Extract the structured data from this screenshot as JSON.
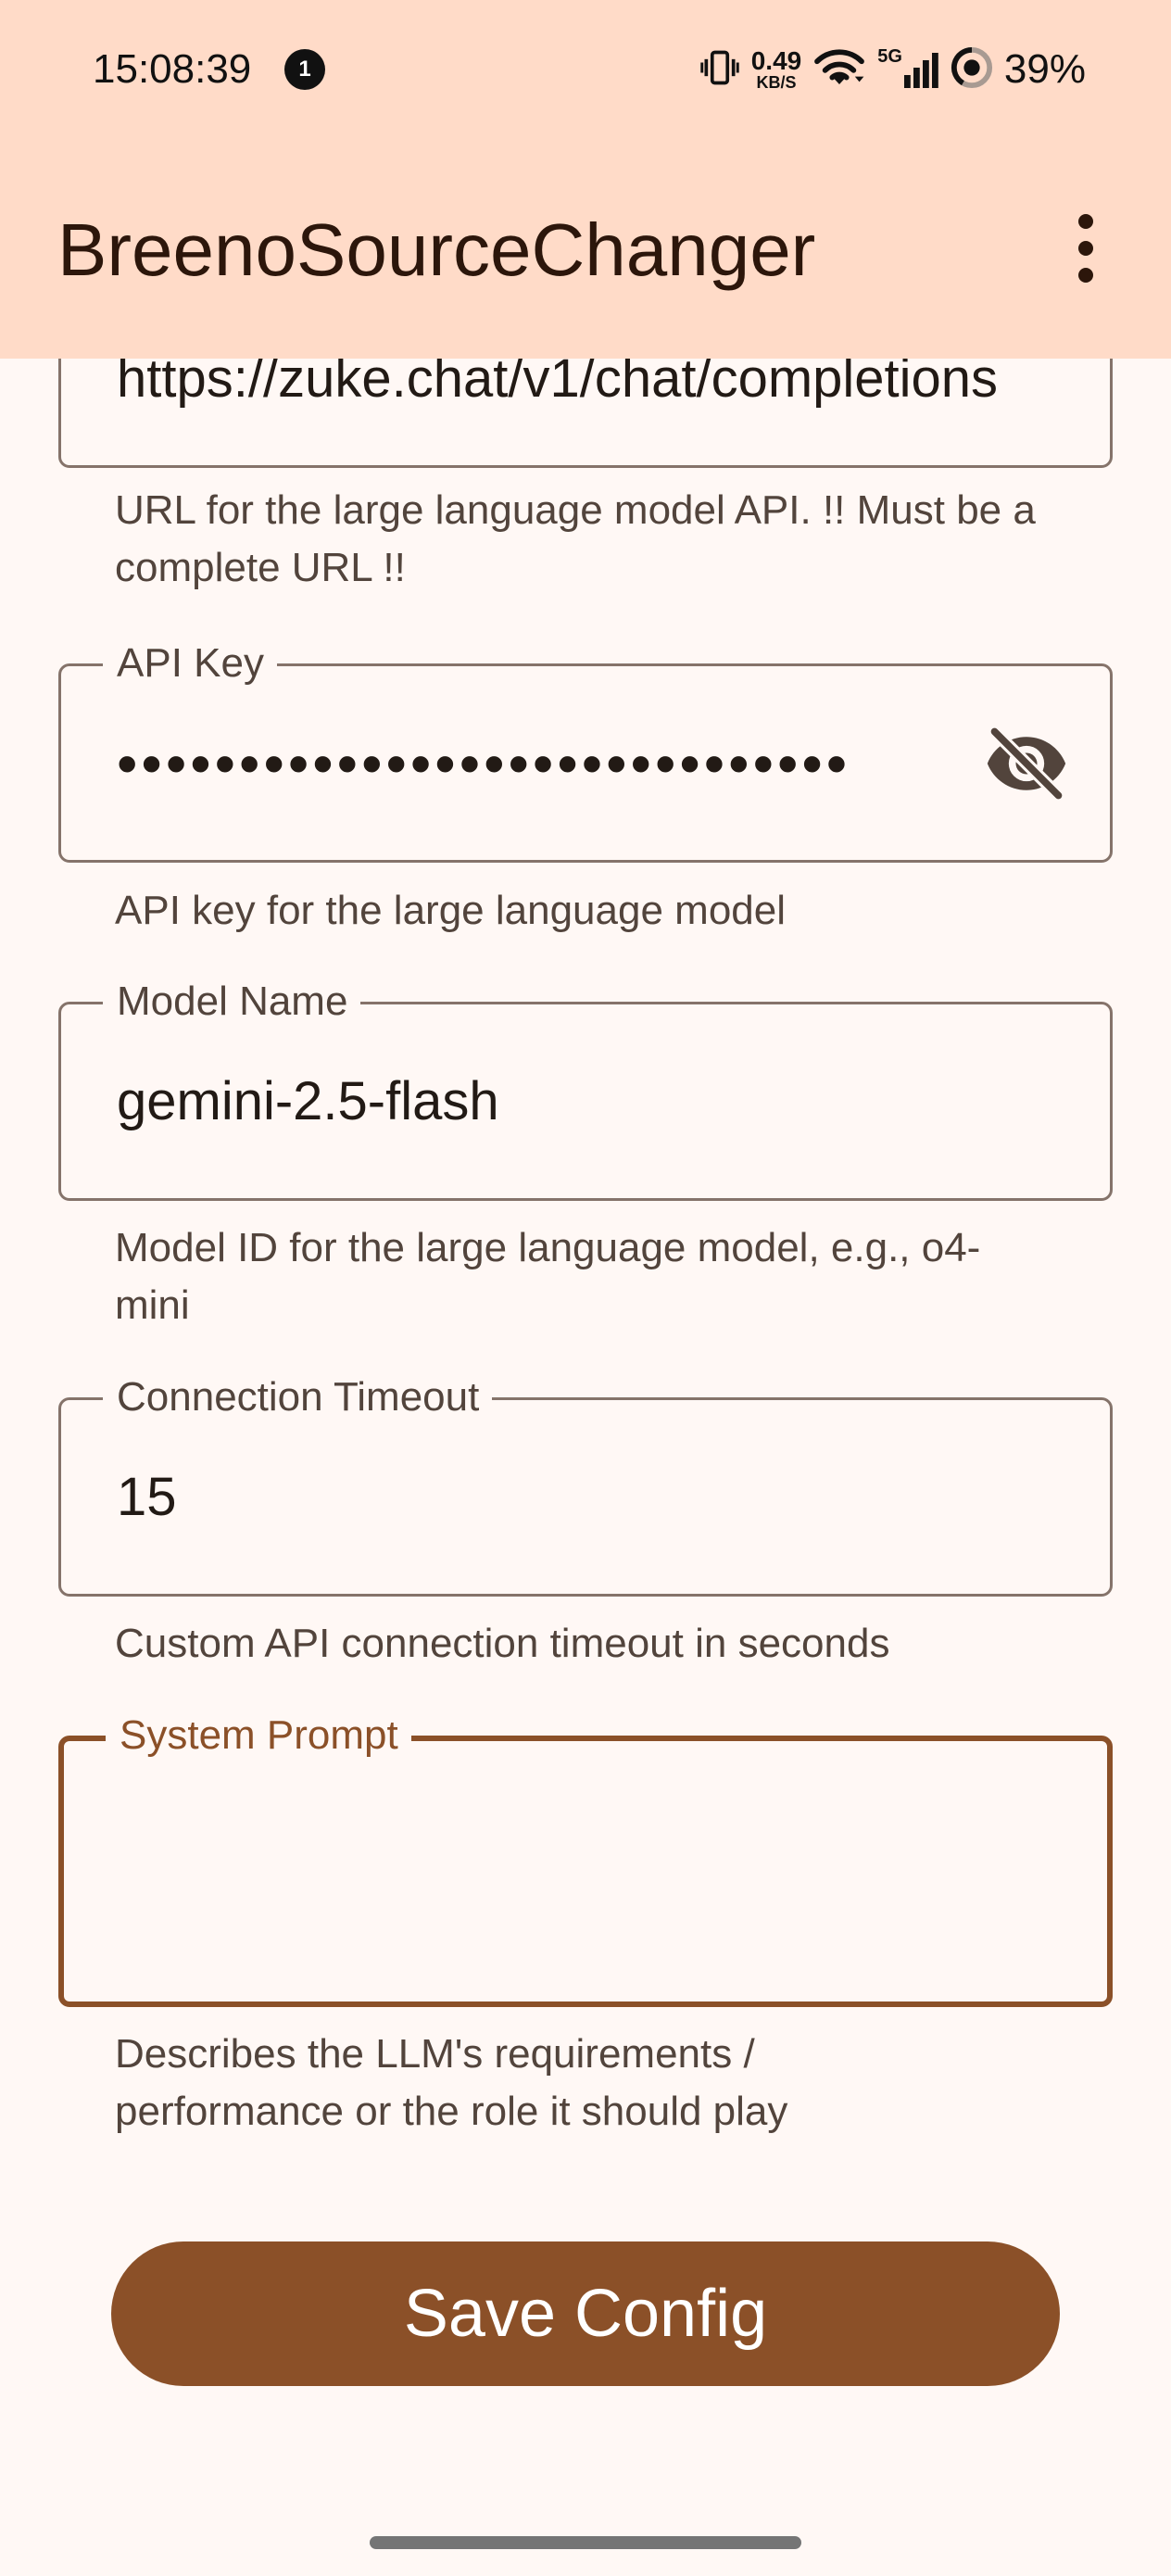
{
  "status_bar": {
    "time": "15:08:39",
    "notification_count": "1",
    "net_speed_value": "0.49",
    "net_speed_unit": "KB/S",
    "network_type": "5G",
    "battery": "39%"
  },
  "app_bar": {
    "title": "BreenoSourceChanger"
  },
  "form": {
    "api_url": {
      "value": "https://zuke.chat/v1/chat/completions",
      "helper": "URL for the large language model API. !! Must be a complete URL !!"
    },
    "api_key": {
      "label": "API Key",
      "masked_value": "••••••••••••••••••••••••••••••",
      "helper": "API key for the large language model"
    },
    "model_name": {
      "label": "Model Name",
      "value": "gemini-2.5-flash",
      "helper": "Model ID for the large language model, e.g., o4-mini"
    },
    "timeout": {
      "label": "Connection Timeout",
      "value": "15",
      "helper": "Custom API connection timeout in seconds"
    },
    "system_prompt": {
      "label": "System Prompt",
      "value": "",
      "helper": "Describes the LLM's requirements / performance or the role it should play"
    },
    "save_label": "Save Config"
  },
  "colors": {
    "app_bar_bg": "#ffdbc8",
    "page_bg": "#fff8f5",
    "primary": "#8b5028",
    "outline": "#85736a"
  },
  "icons": {
    "visibility_toggle": "visibility-off-icon",
    "overflow_menu": "more-vert-icon"
  }
}
